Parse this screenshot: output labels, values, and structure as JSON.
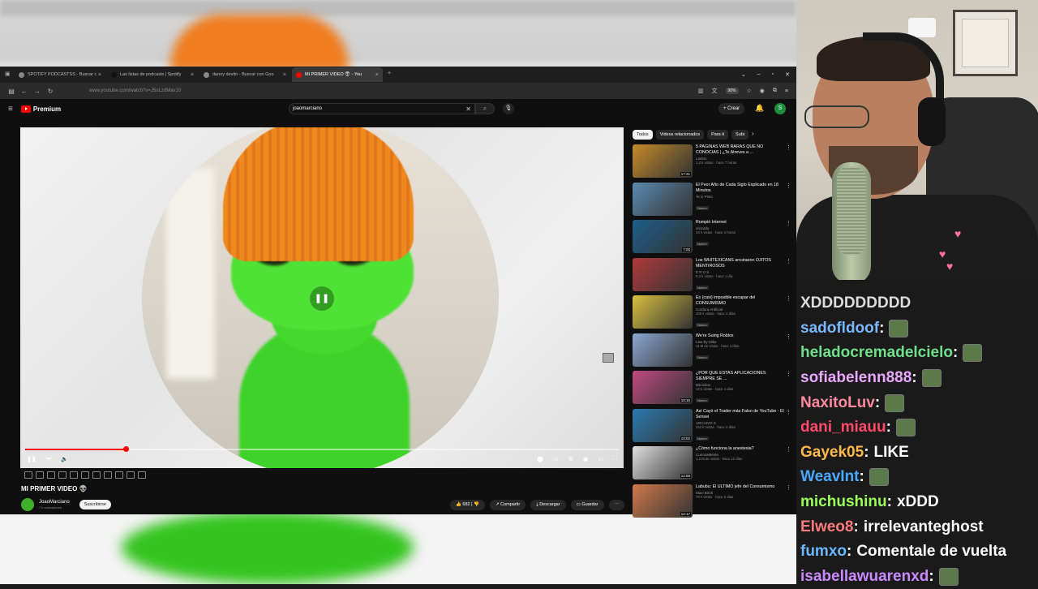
{
  "browser": {
    "tabs": [
      {
        "label": "SPOTIFY PODCASTSS - Buscar c",
        "active": false
      },
      {
        "label": "Las listas de podcasts | Spotify",
        "active": false
      },
      {
        "label": "danny devito - Buscar con Goo",
        "active": false
      },
      {
        "label": "MI PRIMER VIDEO 👽 - You",
        "active": true
      }
    ],
    "url": "www.youtube.com/watch?v=J5oLzdMav10",
    "zoom": "90%"
  },
  "youtube": {
    "logo_label": "Premium",
    "search_query": "joaomarciano",
    "create_label": "Crear",
    "avatar_letter": "S",
    "player": {
      "time": "0:17 / 1:14",
      "progress_fraction": 0.17
    },
    "video_title": "MI PRIMER VIDEO 👽",
    "channel_name": "JoaoMarciano",
    "channel_subs": "7 k suscriptores",
    "subscribe_label": "Suscribirse",
    "likes": "682",
    "share_label": "Compartir",
    "download_label": "Descargar",
    "save_label": "Guardar",
    "chips": [
      "Todos",
      "Videos relacionados",
      "Para ti",
      "Subi"
    ],
    "recommendations": [
      {
        "title": "5 PAGINAS WEB RARAS QUE NO CONOCIAS | ¿Te Atreves a ...",
        "channel": "Lanlon",
        "meta": "1,2 k vistas · hace 7 horas",
        "duration": "17:21",
        "new": "",
        "color": "#c58a2a"
      },
      {
        "title": "El Peor Año de Cada Siglo Explicado en 18 Minutos",
        "channel": "Te lo Pinto",
        "meta": "",
        "duration": "",
        "new": "Nuevo",
        "color": "#5a8ab0"
      },
      {
        "title": "Rompió Internet",
        "channel": "elvicarly",
        "meta": "43 k vistas · hace 4 horas",
        "duration": "7:00",
        "new": "Nuevo",
        "color": "#1d5e8a"
      },
      {
        "title": "Los WHITEXICANS arruinaron OJITOS MENTIROSOS",
        "channel": "E R U S",
        "meta": "9,3 k vistas · hace 1 día",
        "duration": "",
        "new": "Nuevo",
        "color": "#b03a3a"
      },
      {
        "title": "Es (casi) imposible escapar del CONSUMISMO",
        "channel": "Cordura Artificial",
        "meta": "100 k vistas · hace 2 días",
        "duration": "",
        "new": "Nuevo",
        "color": "#d8c040"
      },
      {
        "title": "We're Suing Roblox",
        "channel": "Law By Mike",
        "meta": "11 M de vistas · hace 4 días",
        "duration": "",
        "new": "Nuevo",
        "color": "#8aa8d0"
      },
      {
        "title": "¿POR QUÉ ESTAS APLICACIONES SIEMPRE SE ...",
        "channel": "Bitcódios",
        "meta": "13 k vistas · hace 4 días",
        "duration": "10:16",
        "new": "Nuevo",
        "color": "#c04a80"
      },
      {
        "title": "Así Cayó el Trader más Falso de YouTube - El Sensei",
        "channel": "ARCHIVO X",
        "meta": "252 k vistas · hace 2 días",
        "duration": "10:02",
        "new": "Nuevo",
        "color": "#2a7ab0"
      },
      {
        "title": "¿Cómo funciona la anestesia?",
        "channel": "CuriosaMente",
        "meta": "1,3 M de vistas · hace 12 días",
        "duration": "12:59",
        "new": "",
        "color": "#e0e0e0"
      },
      {
        "title": "Labubu: El ÚLTIMO jefe del Consumismo",
        "channel": "Maxi Brink",
        "meta": "79 k vistas · hace 5 días",
        "duration": "12:17",
        "new": "",
        "color": "#d07a4a"
      }
    ]
  },
  "chat": [
    {
      "user": "XDDDDDDDDD",
      "color": "#dddddd",
      "text": "",
      "emote": false,
      "is_plain": true
    },
    {
      "user": "sadofldoof",
      "color": "#7ab8ff",
      "text": "",
      "emote": true
    },
    {
      "user": "heladocremadelcielo",
      "color": "#6ee08a",
      "text": "",
      "emote": true
    },
    {
      "user": "sofiabelenn888",
      "color": "#e9a8ff",
      "text": "",
      "emote": true
    },
    {
      "user": "NaxitoLuv",
      "color": "#ff8aa0",
      "text": "",
      "emote": true
    },
    {
      "user": "dani_miauu",
      "color": "#ff4a6a",
      "text": "",
      "emote": true
    },
    {
      "user": "Gayek05",
      "color": "#ffb84a",
      "text": "LIKE",
      "emote": false
    },
    {
      "user": "WeavInt",
      "color": "#4aa8ff",
      "text": "",
      "emote": true
    },
    {
      "user": "michushinu",
      "color": "#9aff5a",
      "text": "xDDD",
      "emote": false
    },
    {
      "user": "Elweo8",
      "color": "#ff7a7a",
      "text": "irrelevanteghost",
      "emote": false
    },
    {
      "user": "fumxo",
      "color": "#6ab8ff",
      "text": "Comentale de vuelta",
      "emote": false
    },
    {
      "user": "isabellawuarenxd",
      "color": "#c98aff",
      "text": "",
      "emote": true
    }
  ]
}
